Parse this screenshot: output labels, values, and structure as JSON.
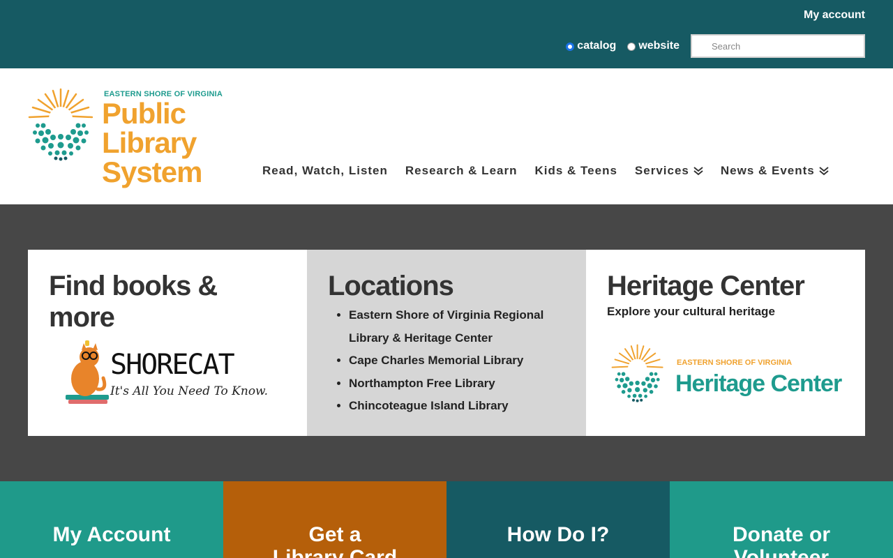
{
  "topbar": {
    "my_account": "My account",
    "radio_catalog": "catalog",
    "radio_website": "website",
    "search_placeholder": "Search"
  },
  "logo": {
    "subtitle": "EASTERN SHORE OF VIRGINIA",
    "title_line1": "Public Library",
    "title_line2": "System"
  },
  "nav": {
    "items": [
      {
        "label": "Read, Watch, Listen"
      },
      {
        "label": "Research & Learn"
      },
      {
        "label": "Kids & Teens"
      },
      {
        "label": "Services"
      },
      {
        "label": "News & Events"
      }
    ]
  },
  "cards": {
    "find": {
      "title": "Find books & more",
      "logo_title": "SHORECAT",
      "logo_tagline": "It's All You Need To Know."
    },
    "locations": {
      "title": "Locations",
      "items": [
        "Eastern Shore of Virginia Regional Library & Heritage Center",
        "Cape Charles Memorial Library",
        "Northampton Free Library",
        "Chincoteague Island Library"
      ]
    },
    "heritage": {
      "title": "Heritage Center",
      "subtitle": "Explore your cultural heritage",
      "logo_sub": "EASTERN SHORE OF VIRGINIA",
      "logo_main": "Heritage Center"
    }
  },
  "tiles": [
    {
      "label": "My Account",
      "color": "#1f9a8a"
    },
    {
      "label": "Get a Library Card",
      "color": "#b55f0a"
    },
    {
      "label": "How Do I?",
      "color": "#165a63"
    },
    {
      "label": "Donate or Volunteer",
      "color": "#1f9a8a"
    }
  ],
  "colors": {
    "topbar": "#165a63",
    "accent_orange": "#f0a22e",
    "accent_teal": "#1e9b8e",
    "band": "#474747"
  }
}
